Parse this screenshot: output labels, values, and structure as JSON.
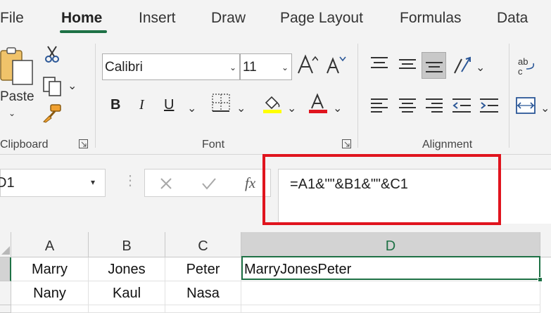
{
  "tabs": [
    {
      "label": "File"
    },
    {
      "label": "Home"
    },
    {
      "label": "Insert"
    },
    {
      "label": "Draw"
    },
    {
      "label": "Page Layout"
    },
    {
      "label": "Formulas"
    },
    {
      "label": "Data"
    }
  ],
  "active_tab": "Home",
  "accent_color": "#1e7145",
  "highlight_color": "#e0141e",
  "ribbon": {
    "clipboard": {
      "paste_label": "Paste",
      "group_label": "Clipboard"
    },
    "font": {
      "font_name": "Calibri",
      "font_size": "11",
      "bold": "B",
      "italic": "I",
      "underline": "U",
      "group_label": "Font"
    },
    "alignment": {
      "group_label": "Alignment"
    }
  },
  "formula_bar": {
    "name_box": "D1",
    "fx_label": "fx",
    "formula": "=A1&\"\"&B1&\"\"&C1"
  },
  "sheet": {
    "columns": [
      "A",
      "B",
      "C",
      "D"
    ],
    "selected_column": "D",
    "rows": [
      [
        "Marry",
        "Jones",
        "Peter",
        "MarryJonesPeter"
      ],
      [
        "Nany",
        "Kaul",
        "Nasa",
        ""
      ]
    ]
  }
}
